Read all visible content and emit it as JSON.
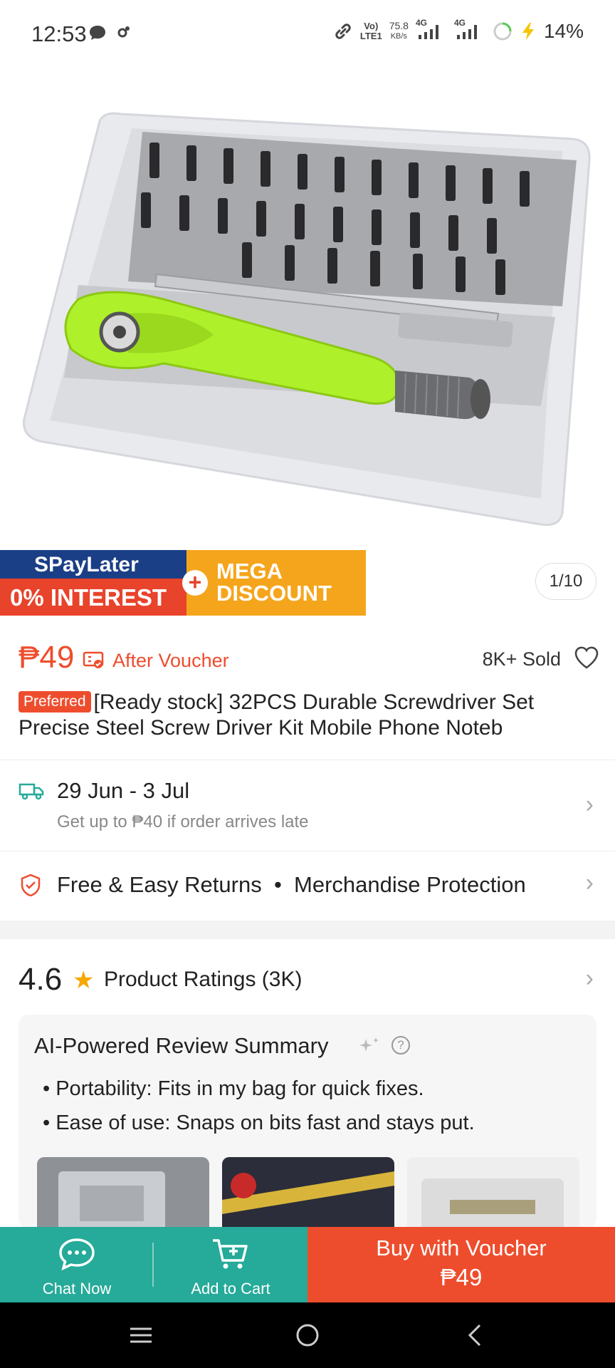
{
  "status_bar": {
    "time": "12:53",
    "volte": "Vo)",
    "lte": "LTE1",
    "speed_value": "75.8",
    "speed_unit": "KB/s",
    "net1": "4G",
    "net2": "4G",
    "battery": "14%"
  },
  "product": {
    "image_icon": "screwdriver-set-image",
    "promo": {
      "spaylater": "SPayLater",
      "interest": "0% INTEREST",
      "mega_line1": "MEGA",
      "mega_line2": "DISCOUNT"
    },
    "pager": "1/10",
    "price": "₱49",
    "after_voucher": "After Voucher",
    "sold": "8K+ Sold",
    "badge": "Preferred",
    "title": "[Ready stock]  32PCS Durable Screwdriver Set Precise Steel Screw Driver Kit Mobile Phone Noteb"
  },
  "shipping": {
    "dates": "29 Jun - 3 Jul",
    "guarantee": "Get up to ₱40 if order arrives late"
  },
  "returns": {
    "text": "Free & Easy Returns  •  Merchandise Protection"
  },
  "ratings": {
    "score": "4.6",
    "label": "Product Ratings (3K)"
  },
  "ai_summary": {
    "title": "AI-Powered Review Summary",
    "bullets": [
      "Portability: Fits in my bag for quick fixes.",
      "Ease of use: Snaps on bits fast and stays put."
    ]
  },
  "actions": {
    "chat": "Chat Now",
    "cart": "Add to Cart",
    "buy_line1": "Buy with Voucher",
    "buy_line2": "₱49"
  },
  "colors": {
    "accent": "#ee4d2d",
    "teal": "#26aa99",
    "star": "#f6a700"
  }
}
